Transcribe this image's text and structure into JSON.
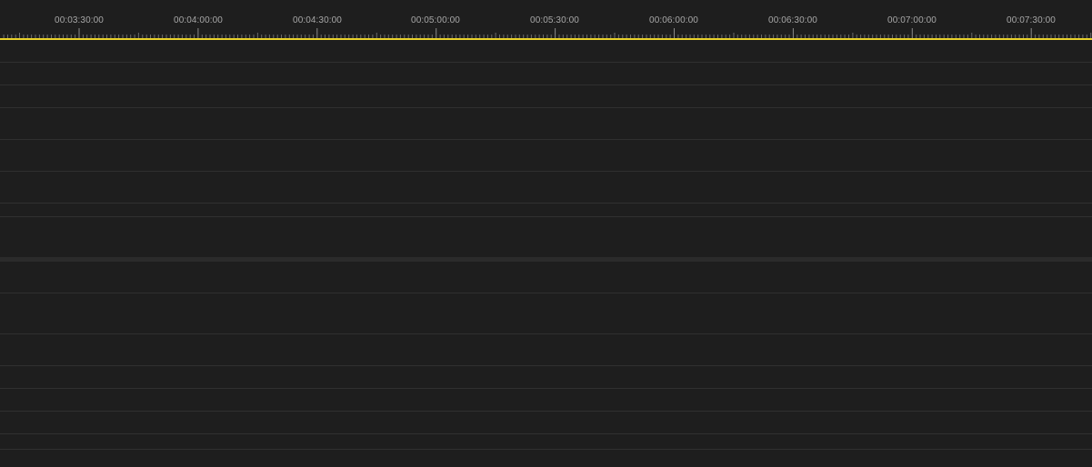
{
  "ruler": {
    "labels": [
      "00:03:30:00",
      "00:04:00:00",
      "00:04:30:00",
      "00:05:00:00",
      "00:05:30:00",
      "00:06:00:00",
      "00:06:30:00",
      "00:07:00:00",
      "00:07:30:00"
    ]
  },
  "colors": {
    "background": "#1e1e1e",
    "playhead": "#e8d12a",
    "tick": "#6a6a6a",
    "label": "#a8a8a8",
    "track_separator": "#303030",
    "section_divider": "#2b2b2b"
  }
}
